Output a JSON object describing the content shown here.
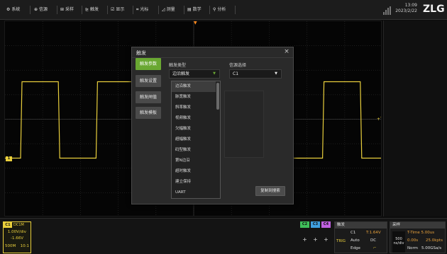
{
  "menu": {
    "items": [
      {
        "icon": "⚙",
        "label": "系统"
      },
      {
        "icon": "⊕",
        "label": "信源"
      },
      {
        "icon": "⊞",
        "label": "采样"
      },
      {
        "icon": "⊵",
        "label": "触发"
      },
      {
        "icon": "☑",
        "label": "显示"
      },
      {
        "icon": "⌗",
        "label": "光标"
      },
      {
        "icon": "◿",
        "label": "测量"
      },
      {
        "icon": "▤",
        "label": "数学"
      },
      {
        "icon": "⚲",
        "label": "分析"
      }
    ]
  },
  "clock": {
    "time": "13:09",
    "date": "2023/2/22"
  },
  "logo": "ZLG",
  "markers": {
    "ch1": "1",
    "trigger_position": "▼",
    "trigger_level": "+T"
  },
  "waveform": {
    "channel": "C1",
    "color": "#e9cf3c",
    "shape": "square",
    "period_divs": 2,
    "high_divs": 2.0,
    "low_divs": -0.7
  },
  "dialog": {
    "title": "触发",
    "close": "×",
    "tabs": [
      "触发参数",
      "触发设置",
      "触发闸值",
      "触发模板"
    ],
    "active_tab": 0,
    "trigger_type_label": "触发类型",
    "trigger_type_value": "边沿触发",
    "source_label": "信源选择",
    "source_value": "C1",
    "dropdown_items": [
      "边沿触发",
      "脉宽触发",
      "斜率触发",
      "视频触发",
      "欠幅触发",
      "超幅触发",
      "码型触发",
      "第N边沿",
      "超时触发",
      "建立保持",
      "UART"
    ],
    "dropdown_selected": 0,
    "copy_button": "复制到搜索"
  },
  "ch1_panel": {
    "name": "C1",
    "coupling": "DC1M",
    "scale": "1.00V/div",
    "offset": "-1.66V",
    "bandwidth": "500M",
    "probe": "10:1"
  },
  "channels": [
    {
      "label": "C2",
      "color": "#3fbf5a"
    },
    {
      "label": "C3",
      "color": "#3f9fe0"
    },
    {
      "label": "C4",
      "color": "#c060e0"
    }
  ],
  "plus_buttons": [
    "+",
    "+",
    "+"
  ],
  "trigger_panel": {
    "title": "触发",
    "label": "TRIG",
    "source": "C1",
    "level": "T:1.64V",
    "mode": "Auto",
    "coupling": "DC",
    "type": "Edge",
    "slope": "⌐"
  },
  "acq_panel": {
    "title": "采样",
    "timebase": "500",
    "timebase_unit": "ns/div",
    "t_time": "T-Time 5.00us",
    "delay": "0.00s",
    "points": "25.0kpts",
    "mode": "Norm",
    "rate": "5.00GSa/s"
  }
}
